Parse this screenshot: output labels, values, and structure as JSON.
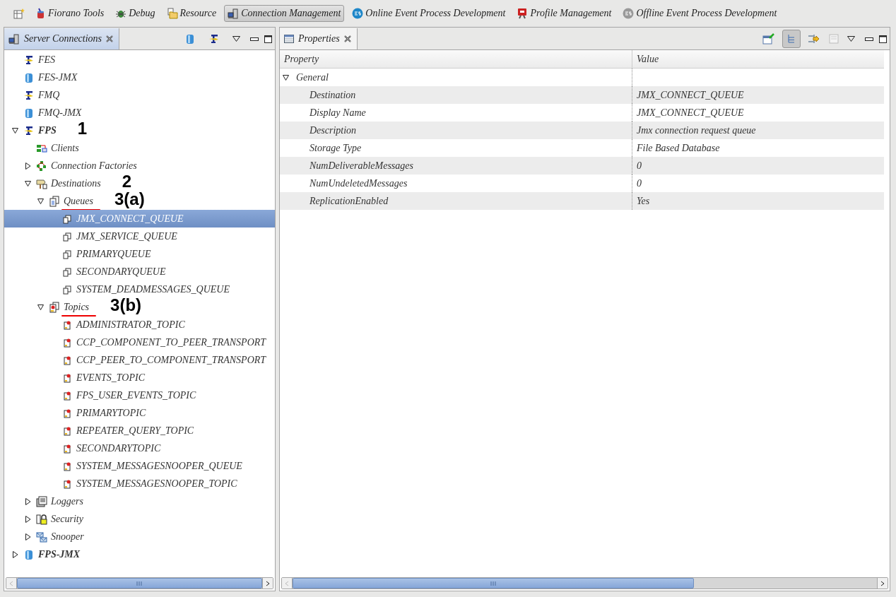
{
  "perspectives": [
    {
      "label": "Fiorano Tools",
      "kind": "tools",
      "selected": false
    },
    {
      "label": "Debug",
      "kind": "debug",
      "selected": false
    },
    {
      "label": "Resource",
      "kind": "resource",
      "selected": false
    },
    {
      "label": "Connection Management",
      "kind": "connection",
      "selected": true
    },
    {
      "label": "Online Event Process Development",
      "kind": "es",
      "selected": false
    },
    {
      "label": "Profile Management",
      "kind": "profile",
      "selected": false
    },
    {
      "label": "Offline Event Process Development",
      "kind": "es-grey",
      "selected": false
    }
  ],
  "server_connections": {
    "title": "Server Connections",
    "tree": [
      {
        "label": "FES",
        "kind": "fes",
        "bold": false,
        "selected": false
      },
      {
        "label": "FES-JMX",
        "kind": "jmx",
        "bold": false,
        "selected": false
      },
      {
        "label": "FMQ",
        "kind": "fes",
        "bold": false,
        "selected": false
      },
      {
        "label": "FMQ-JMX",
        "kind": "jmx",
        "bold": false,
        "selected": false
      },
      {
        "label": "FPS",
        "kind": "fes",
        "bold": true,
        "selected": false,
        "expanded": true,
        "annotation": "1",
        "children": [
          {
            "label": "Clients",
            "kind": "clients",
            "bold": false,
            "selected": false
          },
          {
            "label": "Connection Factories",
            "kind": "factories",
            "bold": false,
            "selected": false,
            "expanded": false
          },
          {
            "label": "Destinations",
            "kind": "destinations",
            "bold": false,
            "selected": false,
            "expanded": true,
            "annotation": "2",
            "children": [
              {
                "label": "Queues",
                "kind": "queue-folder",
                "bold": false,
                "selected": false,
                "expanded": true,
                "underlined": true,
                "annotation": "3(a)",
                "children": [
                  {
                    "label": "JMX_CONNECT_QUEUE",
                    "kind": "queue",
                    "bold": false,
                    "selected": true
                  },
                  {
                    "label": "JMX_SERVICE_QUEUE",
                    "kind": "queue",
                    "bold": false,
                    "selected": false
                  },
                  {
                    "label": "PRIMARYQUEUE",
                    "kind": "queue",
                    "bold": false,
                    "selected": false
                  },
                  {
                    "label": "SECONDARYQUEUE",
                    "kind": "queue",
                    "bold": false,
                    "selected": false
                  },
                  {
                    "label": "SYSTEM_DEADMESSAGES_QUEUE",
                    "kind": "queue",
                    "bold": false,
                    "selected": false
                  }
                ]
              },
              {
                "label": "Topics",
                "kind": "topic-folder",
                "bold": false,
                "selected": false,
                "expanded": true,
                "underlined": true,
                "annotation": "3(b)",
                "children": [
                  {
                    "label": "ADMINISTRATOR_TOPIC",
                    "kind": "topic",
                    "bold": false,
                    "selected": false
                  },
                  {
                    "label": "CCP_COMPONENT_TO_PEER_TRANSPORT",
                    "kind": "topic",
                    "bold": false,
                    "selected": false
                  },
                  {
                    "label": "CCP_PEER_TO_COMPONENT_TRANSPORT",
                    "kind": "topic",
                    "bold": false,
                    "selected": false
                  },
                  {
                    "label": "EVENTS_TOPIC",
                    "kind": "topic",
                    "bold": false,
                    "selected": false
                  },
                  {
                    "label": "FPS_USER_EVENTS_TOPIC",
                    "kind": "topic",
                    "bold": false,
                    "selected": false
                  },
                  {
                    "label": "PRIMARYTOPIC",
                    "kind": "topic",
                    "bold": false,
                    "selected": false
                  },
                  {
                    "label": "REPEATER_QUERY_TOPIC",
                    "kind": "topic",
                    "bold": false,
                    "selected": false
                  },
                  {
                    "label": "SECONDARYTOPIC",
                    "kind": "topic",
                    "bold": false,
                    "selected": false
                  },
                  {
                    "label": "SYSTEM_MESSAGESNOOPER_QUEUE",
                    "kind": "topic",
                    "bold": false,
                    "selected": false
                  },
                  {
                    "label": "SYSTEM_MESSAGESNOOPER_TOPIC",
                    "kind": "topic",
                    "bold": false,
                    "selected": false
                  }
                ]
              }
            ]
          },
          {
            "label": "Loggers",
            "kind": "loggers",
            "bold": false,
            "selected": false,
            "expanded": false
          },
          {
            "label": "Security",
            "kind": "security",
            "bold": false,
            "selected": false,
            "expanded": false
          },
          {
            "label": "Snooper",
            "kind": "snooper",
            "bold": false,
            "selected": false,
            "expanded": false
          }
        ]
      },
      {
        "label": "FPS-JMX",
        "kind": "jmx",
        "bold": true,
        "selected": false,
        "expanded": false
      }
    ]
  },
  "properties": {
    "title": "Properties",
    "columns": [
      "Property",
      "Value"
    ],
    "categories": [
      {
        "label": "General",
        "expanded": true,
        "rows": [
          {
            "property": "Destination",
            "value": "JMX_CONNECT_QUEUE"
          },
          {
            "property": "Display Name",
            "value": "JMX_CONNECT_QUEUE"
          },
          {
            "property": "Description",
            "value": "Jmx connection request queue"
          },
          {
            "property": "Storage Type",
            "value": "File Based Database"
          },
          {
            "property": "NumDeliverableMessages",
            "value": "0"
          },
          {
            "property": "NumUndeletedMessages",
            "value": "0"
          },
          {
            "property": "ReplicationEnabled",
            "value": "Yes"
          }
        ]
      }
    ]
  }
}
